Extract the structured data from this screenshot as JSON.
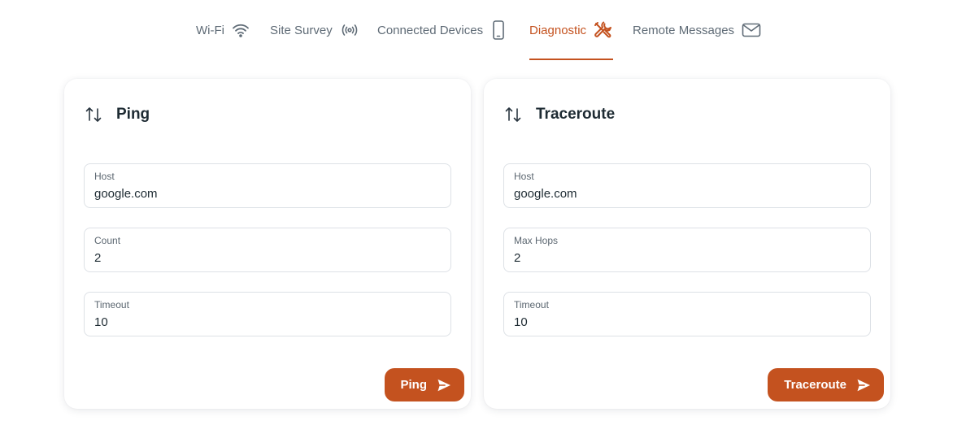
{
  "tabs": [
    {
      "label": "Wi-Fi",
      "icon": "wifi-icon"
    },
    {
      "label": "Site Survey",
      "icon": "broadcast-icon"
    },
    {
      "label": "Connected Devices",
      "icon": "mobile-phone-icon"
    },
    {
      "label": "Diagnostic",
      "icon": "tools-icon",
      "active": true
    },
    {
      "label": "Remote Messages",
      "icon": "envelope-icon"
    }
  ],
  "ping": {
    "title": "Ping",
    "icon": "swap-vertical-icon",
    "fields": [
      {
        "label": "Host",
        "value": "google.com"
      },
      {
        "label": "Count",
        "value": "2"
      },
      {
        "label": "Timeout",
        "value": "10"
      }
    ],
    "button_label": "Ping",
    "button_icon": "send-icon"
  },
  "traceroute": {
    "title": "Traceroute",
    "icon": "swap-vertical-icon",
    "fields": [
      {
        "label": "Host",
        "value": "google.com"
      },
      {
        "label": "Max Hops",
        "value": "2"
      },
      {
        "label": "Timeout",
        "value": "10"
      }
    ],
    "button_label": "Traceroute",
    "button_icon": "send-icon"
  },
  "colors": {
    "accent": "#c4521f",
    "tab_inactive": "#5f6b76",
    "text": "#1e2b33",
    "border": "#dde1e6"
  }
}
